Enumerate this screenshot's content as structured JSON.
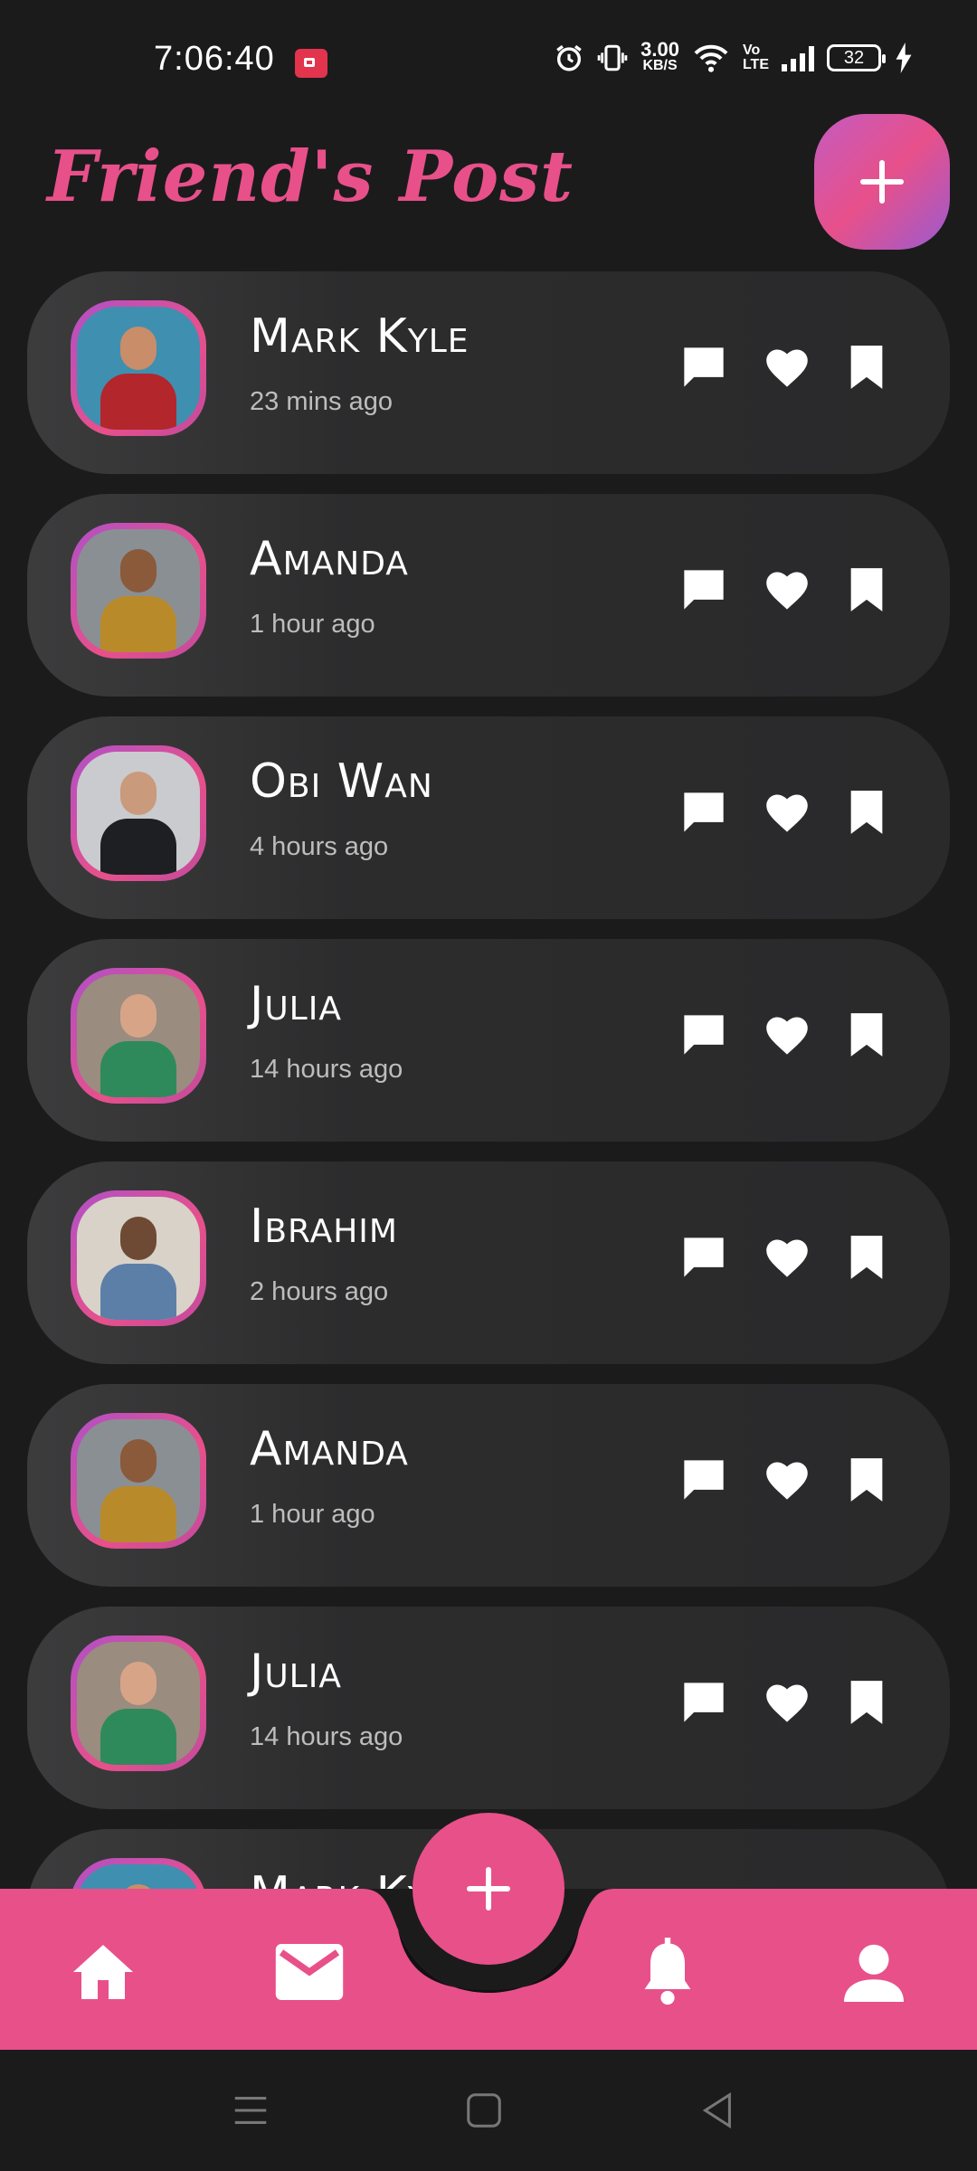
{
  "status_bar": {
    "time": "7:06:40",
    "net_speed_value": "3.00",
    "net_speed_unit": "KB/S",
    "volte_top": "Vo",
    "volte_bottom": "LTE",
    "battery": "32",
    "icons": [
      "screen-record-icon",
      "alarm-icon",
      "vibrate-icon",
      "wifi-icon",
      "signal-icon",
      "battery-icon",
      "charging-icon"
    ]
  },
  "header": {
    "title": "Friend's Post"
  },
  "posts": [
    {
      "name": "Mark Kyle",
      "time": "23 mins ago",
      "avatar_bg": "#3f8fb0",
      "shirt": "#b3262c",
      "skin": "#c98d6a"
    },
    {
      "name": "Amanda",
      "time": "1 hour ago",
      "avatar_bg": "#8a8f93",
      "shirt": "#b98a2a",
      "skin": "#8a5a3a"
    },
    {
      "name": "Obi Wan",
      "time": "4 hours ago",
      "avatar_bg": "#c9cbcf",
      "shirt": "#1e1f23",
      "skin": "#c99a7c"
    },
    {
      "name": "Julia",
      "time": "14 hours ago",
      "avatar_bg": "#9a8c7f",
      "shirt": "#2e8a5a",
      "skin": "#d8a488"
    },
    {
      "name": "Ibrahim",
      "time": "2 hours ago",
      "avatar_bg": "#d8d2c8",
      "shirt": "#5c7fa8",
      "skin": "#6e4a34"
    },
    {
      "name": "Amanda",
      "time": "1 hour ago",
      "avatar_bg": "#8a8f93",
      "shirt": "#b98a2a",
      "skin": "#8a5a3a"
    },
    {
      "name": "Julia",
      "time": "14 hours ago",
      "avatar_bg": "#9a8c7f",
      "shirt": "#2e8a5a",
      "skin": "#d8a488"
    },
    {
      "name": "Mark Kyle",
      "time": "",
      "avatar_bg": "#3f8fb0",
      "shirt": "#b3262c",
      "skin": "#c98d6a"
    }
  ],
  "post_actions": [
    "comment-icon",
    "heart-icon",
    "bookmark-icon"
  ],
  "bottom_nav": {
    "items": [
      "home-icon",
      "mail-icon",
      "add-icon",
      "bell-icon",
      "profile-icon"
    ]
  },
  "colors": {
    "accent": "#e8508a",
    "background": "#1b1b1c",
    "card": "#2c2c2d"
  }
}
